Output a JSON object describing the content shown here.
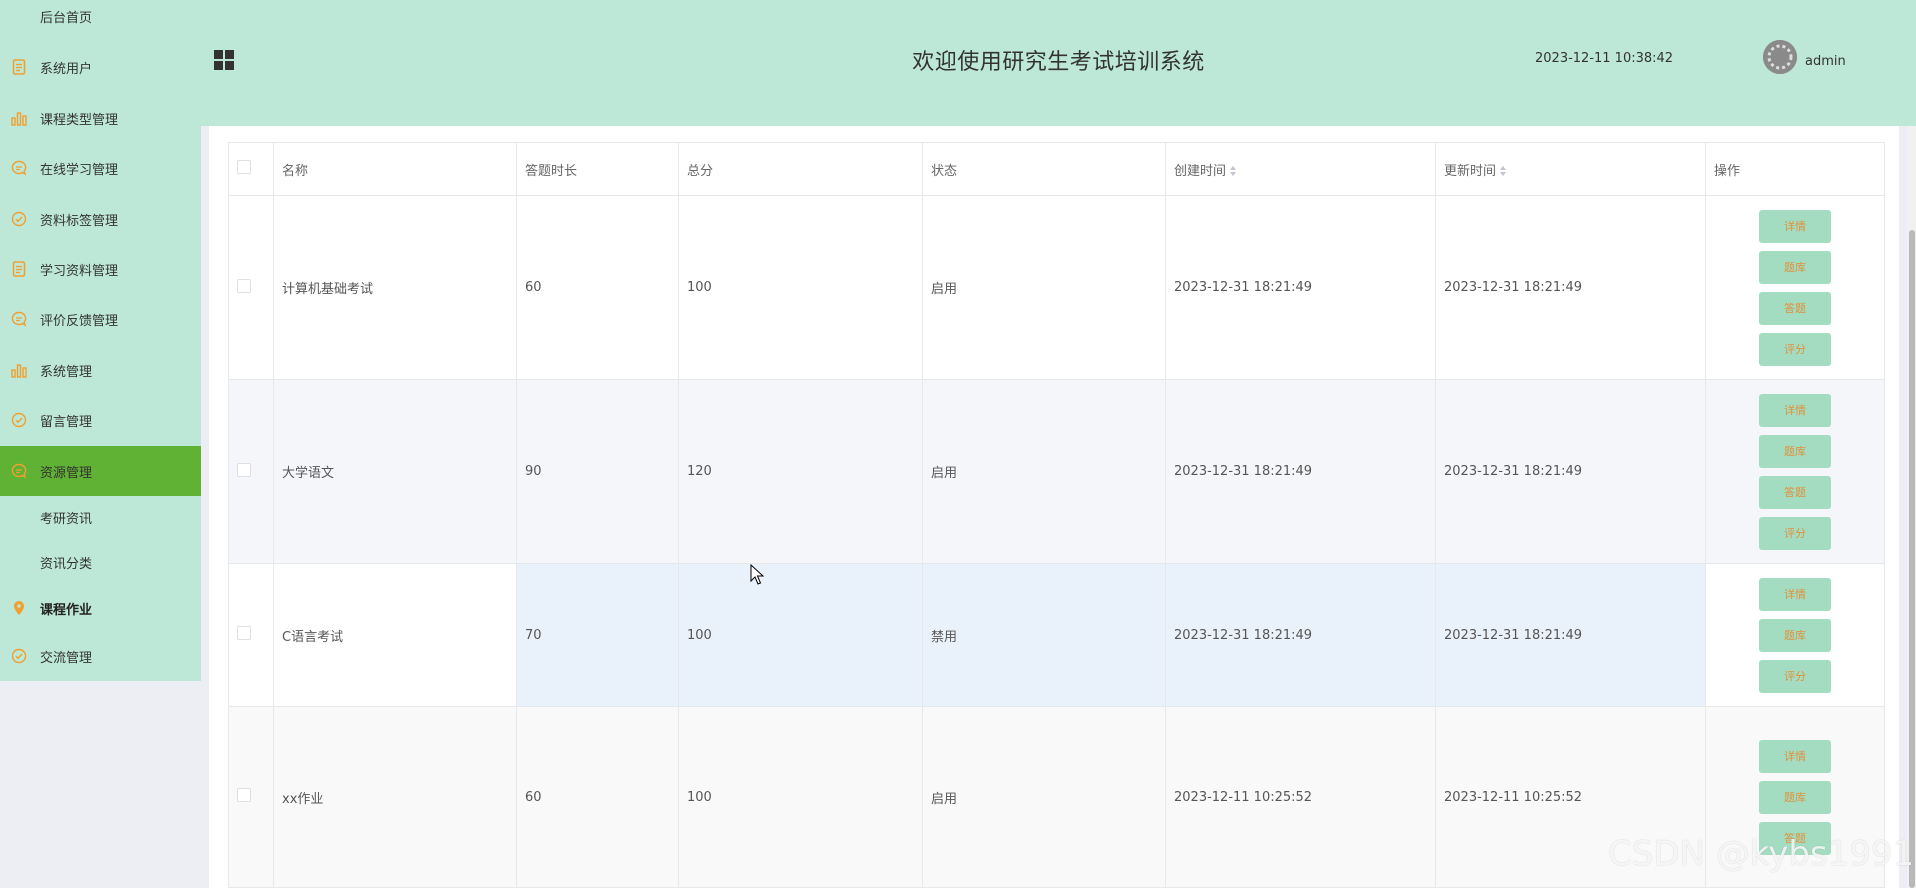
{
  "sidebar": {
    "items": [
      {
        "label": "后台首页",
        "icon": "none"
      },
      {
        "label": "系统用户",
        "icon": "document-icon"
      },
      {
        "label": "课程类型管理",
        "icon": "bar-chart-icon"
      },
      {
        "label": "在线学习管理",
        "icon": "chat-bubble-icon"
      },
      {
        "label": "资料标签管理",
        "icon": "check-circle-icon"
      },
      {
        "label": "学习资料管理",
        "icon": "document-icon"
      },
      {
        "label": "评价反馈管理",
        "icon": "chat-bubble-icon"
      },
      {
        "label": "系统管理",
        "icon": "bar-chart-icon"
      },
      {
        "label": "留言管理",
        "icon": "check-circle-icon"
      },
      {
        "label": "资源管理",
        "icon": "chat-bubble-icon"
      },
      {
        "label": "考研资讯",
        "icon": "none"
      },
      {
        "label": "资讯分类",
        "icon": "none"
      },
      {
        "label": "课程作业",
        "icon": "location-pin-icon"
      },
      {
        "label": "交流管理",
        "icon": "check-circle-icon"
      }
    ],
    "active_index": 9,
    "accent_color": "#5fb233",
    "icon_color": "#f0a030"
  },
  "header": {
    "title": "欢迎使用研究生考试培训系统",
    "datetime": "2023-12-11 10:38:42",
    "username": "admin"
  },
  "table": {
    "columns": [
      "名称",
      "答题时长",
      "总分",
      "状态",
      "创建时间",
      "更新时间",
      "操作"
    ],
    "rows": [
      {
        "name": "计算机基础考试",
        "duration": "60",
        "score": "100",
        "status": "启用",
        "created": "2023-12-31 18:21:49",
        "updated": "2023-12-31 18:21:49",
        "actions": [
          "详情",
          "题库",
          "答题",
          "评分"
        ]
      },
      {
        "name": "大学语文",
        "duration": "90",
        "score": "120",
        "status": "启用",
        "created": "2023-12-31 18:21:49",
        "updated": "2023-12-31 18:21:49",
        "actions": [
          "详情",
          "题库",
          "答题",
          "评分"
        ]
      },
      {
        "name": "C语言考试",
        "duration": "70",
        "score": "100",
        "status": "禁用",
        "created": "2023-12-31 18:21:49",
        "updated": "2023-12-31 18:21:49",
        "actions": [
          "详情",
          "题库",
          "评分"
        ]
      },
      {
        "name": "xx作业",
        "duration": "60",
        "score": "100",
        "status": "启用",
        "created": "2023-12-11 10:25:52",
        "updated": "2023-12-11 10:25:52",
        "actions": [
          "详情",
          "题库",
          "答题"
        ]
      }
    ]
  },
  "watermark": "CSDN @kybs1991"
}
